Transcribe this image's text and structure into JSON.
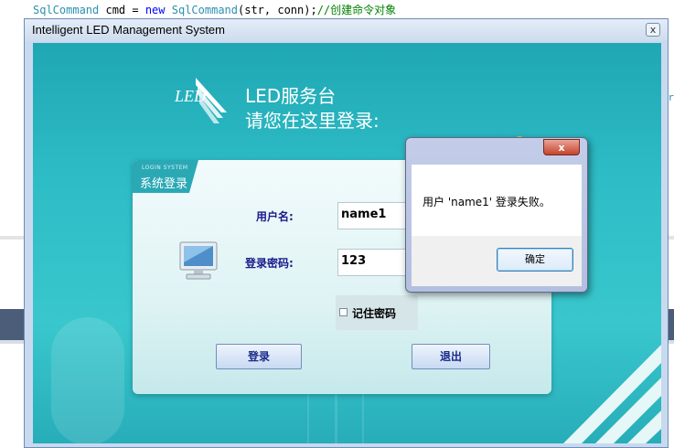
{
  "ide": {
    "code": {
      "type1": "SqlCommand",
      "mid": " cmd = ",
      "kw": "new",
      "type2": " SqlCommand",
      "args": "(str, conn);",
      "comment": "//创建命令对象"
    },
    "edge_text": "er"
  },
  "window": {
    "title": "Intelligent LED Management System",
    "close_label": "x"
  },
  "header": {
    "logo_text": "LED",
    "title": "LED服务台",
    "subtitle": "请您在这里登录:"
  },
  "login": {
    "tab_small": "LOGIN SYSTEM",
    "tab_label": "系统登录",
    "username_label": "用户名:",
    "username_value": "name1",
    "password_label": "登录密码:",
    "password_value": "123",
    "remember_label": "记住密码",
    "login_button": "登录",
    "exit_button": "退出"
  },
  "message_box": {
    "close_label": "x",
    "text": "用户 'name1' 登录失败。",
    "ok_button": "确定"
  }
}
